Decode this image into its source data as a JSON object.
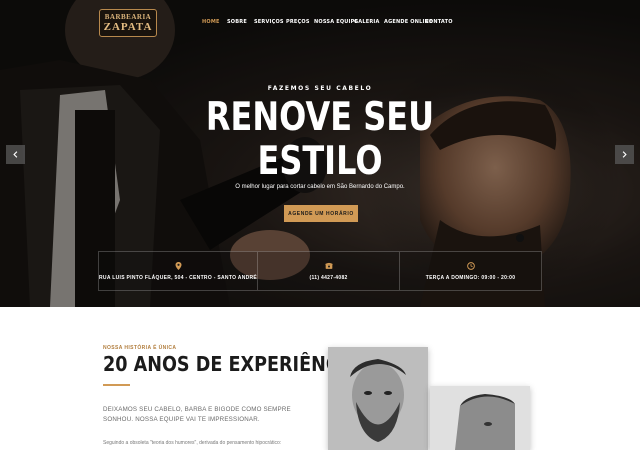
{
  "brand": {
    "logo_line1": "BARBEARIA",
    "logo_line2": "ZAPATA"
  },
  "nav": {
    "items": [
      "HOME",
      "SOBRE",
      "SERVIÇOS",
      "PREÇOS",
      "NOSSA EQUIPE",
      "GALERIA",
      "AGENDE ONLINE",
      "CONTATO"
    ],
    "active": "HOME"
  },
  "hero": {
    "subtitle": "FAZEMOS SEU CABELO",
    "title_line1": "RENOVE SEU",
    "title_line2": "ESTILO",
    "description": "O melhor lugar para cortar cabelo em São Bernardo do Campo.",
    "cta_label": "AGENDE UM HORÁRIO",
    "prev_icon": "chevron-left-icon",
    "next_icon": "chevron-right-icon"
  },
  "info": {
    "address": "RUA LUIS PINTO FLÁQUER, 504 - CENTRO - SANTO ANDRÉ",
    "address_icon": "map-pin-icon",
    "phone": "(11) 4427-4082",
    "phone_icon": "phone-icon",
    "hours": "TERÇA A DOMINGO: 09:00 - 20:00",
    "hours_icon": "clock-icon"
  },
  "about": {
    "kicker": "NOSSA HISTÓRIA É ÚNICA",
    "title": "20 ANOS DE EXPERIÊNCIA",
    "lead": "DEIXAMOS SEU CABELO, BARBA E BIGODE COMO SEMPRE SONHOU. NOSSA EQUIPE VAI TE IMPRESSIONAR.",
    "body": "Seguindo a obsoleta \"teoria dos humores\", derivada do pensamento hipocrático:"
  },
  "colors": {
    "accent": "#d19a55",
    "dark": "#141210",
    "text": "#1b1b1b"
  }
}
